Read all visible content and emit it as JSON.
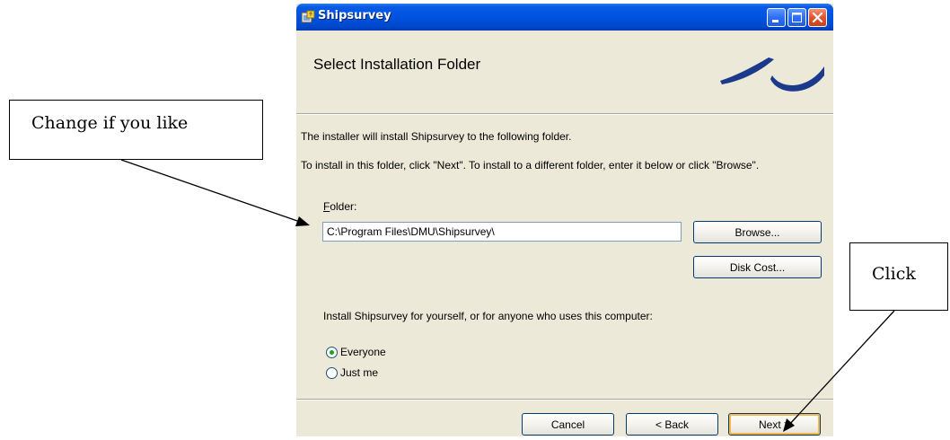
{
  "window": {
    "title": "Shipsurvey",
    "heading": "Select Installation Folder"
  },
  "body": {
    "intro_line1": "The installer will install Shipsurvey to the following folder.",
    "intro_line2": "To install in this folder, click \"Next\". To install to a different folder, enter it below or click \"Browse\".",
    "folder_label_mnemonic": "F",
    "folder_label_rest": "older:",
    "folder_value": "C:\\Program Files\\DMU\\Shipsurvey\\",
    "browse_label": "Browse...",
    "disk_cost_label": "Disk Cost...",
    "install_for_text": "Install Shipsurvey for yourself, or for anyone who uses this computer:",
    "radio_options": [
      {
        "label": "Everyone",
        "selected": true
      },
      {
        "label": "Just me",
        "selected": false
      }
    ]
  },
  "footer": {
    "cancel_label": "Cancel",
    "back_label": "< Back",
    "next_label": "Next >"
  },
  "annotations": {
    "change_text": "Change if you like",
    "click_text": "Click"
  },
  "colors": {
    "titlebar": "#0054e3",
    "dialog_bg": "#ece9d8",
    "radio_dot": "#21a121",
    "logo": "#1b3a8c"
  }
}
